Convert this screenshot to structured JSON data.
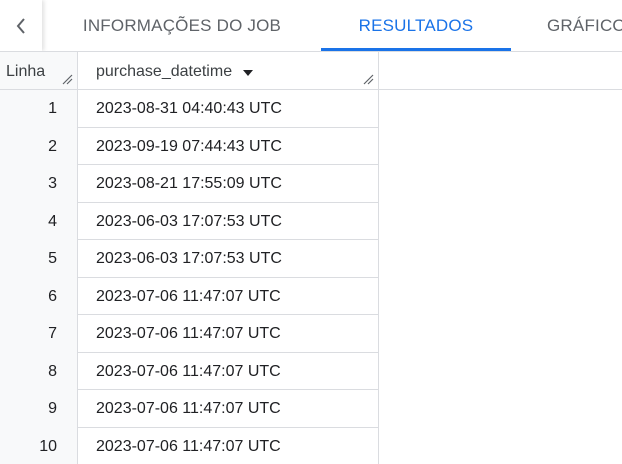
{
  "tabs": [
    {
      "label": "INFORMAÇÕES DO JOB",
      "active": false
    },
    {
      "label": "RESULTADOS",
      "active": true
    },
    {
      "label": "GRÁFICO",
      "active": false
    }
  ],
  "table": {
    "row_header": "Linha",
    "column_header": "purchase_datetime",
    "rows": [
      {
        "n": "1",
        "value": "2023-08-31 04:40:43 UTC"
      },
      {
        "n": "2",
        "value": "2023-09-19 07:44:43 UTC"
      },
      {
        "n": "3",
        "value": "2023-08-21 17:55:09 UTC"
      },
      {
        "n": "4",
        "value": "2023-06-03 17:07:53 UTC"
      },
      {
        "n": "5",
        "value": "2023-06-03 17:07:53 UTC"
      },
      {
        "n": "6",
        "value": "2023-07-06 11:47:07 UTC"
      },
      {
        "n": "7",
        "value": "2023-07-06 11:47:07 UTC"
      },
      {
        "n": "8",
        "value": "2023-07-06 11:47:07 UTC"
      },
      {
        "n": "9",
        "value": "2023-07-06 11:47:07 UTC"
      },
      {
        "n": "10",
        "value": "2023-07-06 11:47:07 UTC"
      }
    ]
  },
  "colors": {
    "accent": "#1a73e8",
    "border": "#dadce0",
    "tab_text": "#5f6368"
  },
  "icons": {
    "back": "chevron-left-icon",
    "sort": "caret-down-icon",
    "resize": "resize-handle-icon"
  }
}
